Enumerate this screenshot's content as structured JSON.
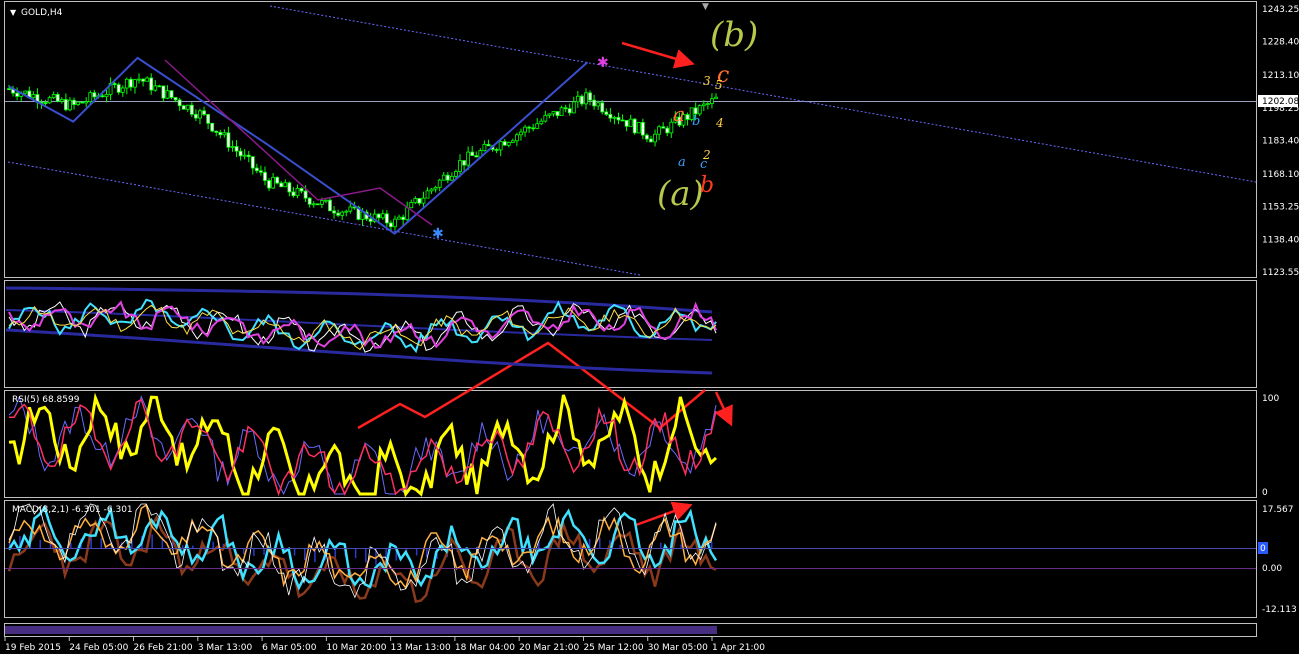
{
  "chart_title": "GOLD,H4",
  "price_axis": [
    "1243.25",
    "1228.40",
    "1213.10",
    "1198.25",
    "1183.40",
    "1168.10",
    "1153.25",
    "1138.40",
    "1123.55"
  ],
  "current_price": "1202.08",
  "rsi_label": "RSI(5) 68.8599",
  "rsi_axis": [
    "100",
    "0"
  ],
  "macd_label": "MACD(8,2,1) -6.301 -6.301",
  "macd_axis": [
    "17.567",
    "0.00",
    "-12.113"
  ],
  "macd_marker": "0",
  "time_axis": [
    "19 Feb 2015",
    "24 Feb 05:00",
    "26 Feb 21:00",
    "3 Mar 13:00",
    "6 Mar 05:00",
    "10 Mar 20:00",
    "13 Mar 13:00",
    "18 Mar 04:00",
    "20 Mar 21:00",
    "25 Mar 12:00",
    "30 Mar 05:00",
    "1 Apr 21:00"
  ],
  "wave_labels": {
    "big_b": "(b)",
    "big_a": "(a)",
    "a_orange": "a",
    "b_red": "b",
    "c_orange": "c",
    "sub_a": "a",
    "sub_b": "b",
    "sub_c": "c",
    "n2": "2",
    "n3": "3",
    "n4": "4",
    "n5": "5",
    "n3b": "3"
  },
  "colors": {
    "candle": "#00ff00",
    "zigzag": "#3a4fd0",
    "channel": "#5a5aff",
    "arrow": "#ff2020",
    "wave_green": "#b8c84a",
    "wave_orange": "#ff7030",
    "wave_red": "#ff3a20",
    "wave_blue": "#3aa0ff",
    "wave_yellow": "#ffd040"
  },
  "chart_data": {
    "type": "line",
    "symbol": "GOLD",
    "timeframe": "H4",
    "x": [
      "19 Feb 2015",
      "24 Feb 05:00",
      "26 Feb 21:00",
      "3 Mar 13:00",
      "6 Mar 05:00",
      "10 Mar 20:00",
      "13 Mar 13:00",
      "18 Mar 04:00",
      "20 Mar 21:00",
      "25 Mar 12:00",
      "30 Mar 05:00",
      "1 Apr 21:00"
    ],
    "series": [
      {
        "values": [
          1207,
          1199,
          1212,
          1195,
          1165,
          1153,
          1146,
          1173,
          1188,
          1203,
          1185,
          1202
        ]
      }
    ],
    "ylim": [
      1123.55,
      1243.25
    ],
    "zigzag": [
      {
        "x": "19 Feb 2015",
        "y": 1208
      },
      {
        "x": "24 Feb 05:00",
        "y": 1192
      },
      {
        "x": "26 Feb 21:00",
        "y": 1221
      },
      {
        "x": "6 Mar 05:00",
        "y": 1182
      },
      {
        "x": "13 Mar 13:00",
        "y": 1141
      },
      {
        "x": "25 Mar 12:00",
        "y": 1219
      }
    ]
  }
}
